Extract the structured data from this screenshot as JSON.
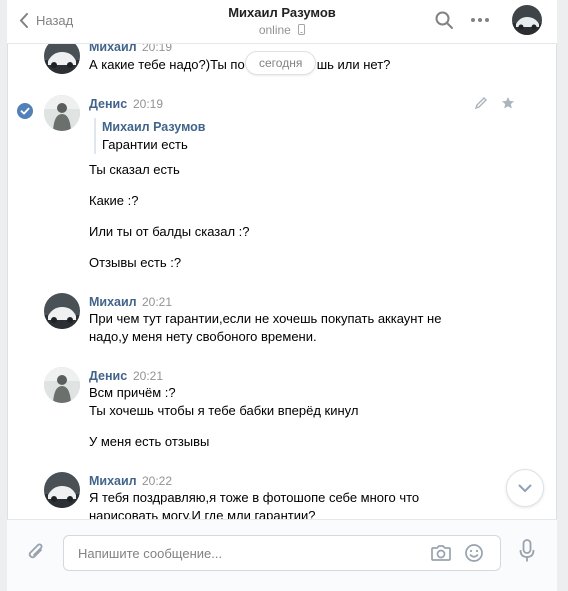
{
  "header": {
    "back_label": "Назад",
    "title": "Михаил Разумов",
    "status": "online"
  },
  "date_divider": "сегодня",
  "messages": [
    {
      "author": "Михаил",
      "time": "20:19",
      "lines": [
        "А какие тебе надо?)Ты пока брать будешь или нет?"
      ],
      "visible_prefix": "А какие тебе надо?)Ты по",
      "visible_suffix": "шь или нет?"
    },
    {
      "author": "Денис",
      "time": "20:19",
      "selected": true,
      "quote": {
        "author": "Михаил Разумов",
        "text": "Гарантии есть"
      },
      "paragraphs": [
        "Ты сказал есть",
        "Какие :?",
        "Или ты от балды сказал :?",
        "Отзывы есть :?"
      ]
    },
    {
      "author": "Михаил",
      "time": "20:21",
      "lines": [
        "При чем тут гарантии,если не хочешь покупать аккаунт не",
        "надо,у меня нету свобоного времени."
      ]
    },
    {
      "author": "Денис",
      "time": "20:21",
      "lines": [
        "Всм причём :?",
        "Ты хочешь чтобы я тебе бабки вперёд кинул"
      ],
      "extra": "У меня есть отзывы"
    },
    {
      "author": "Михаил",
      "time": "20:22",
      "lines": [
        "Я тебя поздравляю,я тоже в фотошопе себе много что",
        "нарисовать могу.И где мли гарантии?"
      ]
    }
  ],
  "composer": {
    "placeholder": "Напишите сообщение..."
  },
  "colors": {
    "link": "#42648b",
    "accent": "#5181b8",
    "muted": "#939393",
    "background": "#edeef0"
  },
  "icons": [
    "chevron-left-icon",
    "phone-icon",
    "search-icon",
    "more-icon",
    "edit-icon",
    "star-icon",
    "check-icon",
    "chevron-down-icon",
    "paperclip-icon",
    "camera-icon",
    "smile-icon",
    "microphone-icon"
  ]
}
